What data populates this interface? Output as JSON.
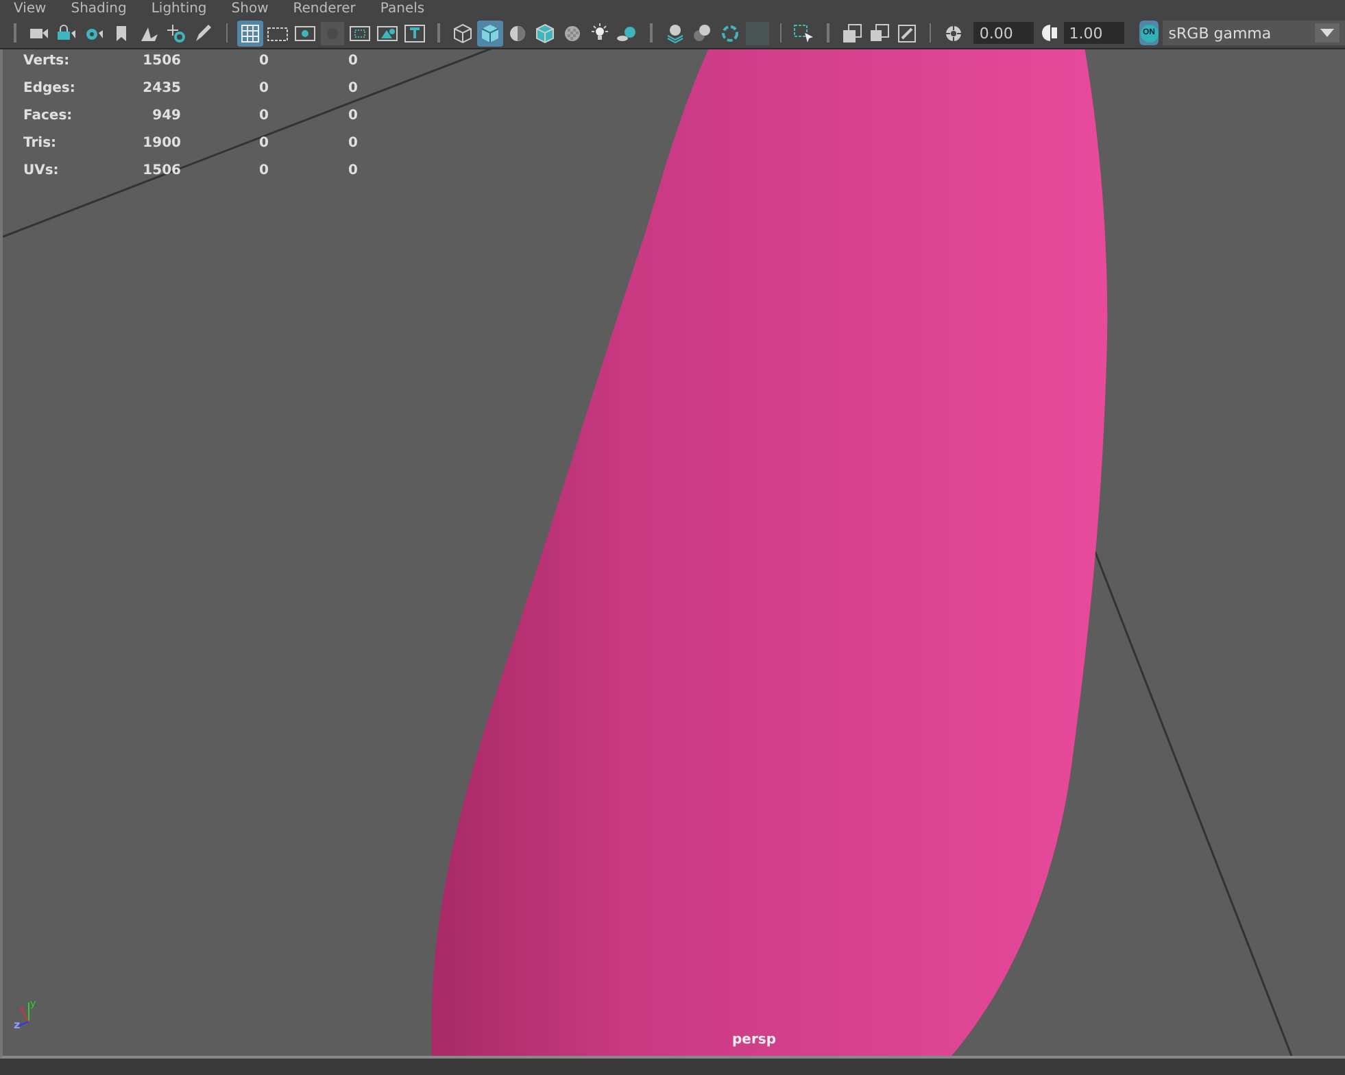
{
  "menu": [
    "View",
    "Shading",
    "Lighting",
    "Show",
    "Renderer",
    "Panels"
  ],
  "toolbar": [
    {
      "kind": "sep"
    },
    {
      "kind": "camera",
      "selected": false
    },
    {
      "kind": "lock",
      "selected": false
    },
    {
      "kind": "camera-gear",
      "selected": false
    },
    {
      "kind": "bookmark",
      "selected": false
    },
    {
      "kind": "plane",
      "selected": false
    },
    {
      "kind": "move",
      "selected": false
    },
    {
      "kind": "pencil",
      "selected": false
    },
    {
      "kind": "sep"
    },
    {
      "kind": "grid",
      "selected": true
    },
    {
      "kind": "film",
      "selected": false
    },
    {
      "kind": "dot",
      "selected": false
    },
    {
      "kind": "dark-dot",
      "selected": false
    },
    {
      "kind": "dashed",
      "selected": false
    },
    {
      "kind": "triangle",
      "selected": false
    },
    {
      "kind": "letter",
      "selected": false
    },
    {
      "kind": "sep"
    },
    {
      "kind": "wire-cube",
      "selected": false
    },
    {
      "kind": "solid-cube",
      "selected": true
    },
    {
      "kind": "half-sphere",
      "selected": false
    },
    {
      "kind": "box-cube",
      "selected": false
    },
    {
      "kind": "checker",
      "selected": false
    },
    {
      "kind": "bulb",
      "selected": false
    },
    {
      "kind": "ball",
      "selected": false
    },
    {
      "kind": "sep"
    },
    {
      "kind": "stack",
      "selected": false
    },
    {
      "kind": "spheres",
      "selected": false
    },
    {
      "kind": "ring",
      "selected": false
    },
    {
      "kind": "square",
      "selected": false
    },
    {
      "kind": "sep"
    },
    {
      "kind": "select",
      "selected": false
    },
    {
      "kind": "sep"
    },
    {
      "kind": "overlap",
      "selected": false
    },
    {
      "kind": "corner",
      "selected": false
    },
    {
      "kind": "slash",
      "selected": false
    },
    {
      "kind": "sep"
    },
    {
      "kind": "aperture",
      "selected": false
    }
  ],
  "exposure": "0.00",
  "gamma": "1.00",
  "color_management": {
    "label": "ON",
    "on": true
  },
  "view_transform": "sRGB gamma",
  "stats": [
    {
      "label": "Verts:",
      "values": [
        "1506",
        "0",
        "0"
      ]
    },
    {
      "label": "Edges:",
      "values": [
        "2435",
        "0",
        "0"
      ]
    },
    {
      "label": "Faces:",
      "values": [
        "949",
        "0",
        "0"
      ]
    },
    {
      "label": "Tris:",
      "values": [
        "1900",
        "0",
        "0"
      ]
    },
    {
      "label": "UVs:",
      "values": [
        "1506",
        "0",
        "0"
      ]
    }
  ],
  "axis": {
    "x": "x",
    "y": "y",
    "z": "z"
  },
  "camera": "persp"
}
